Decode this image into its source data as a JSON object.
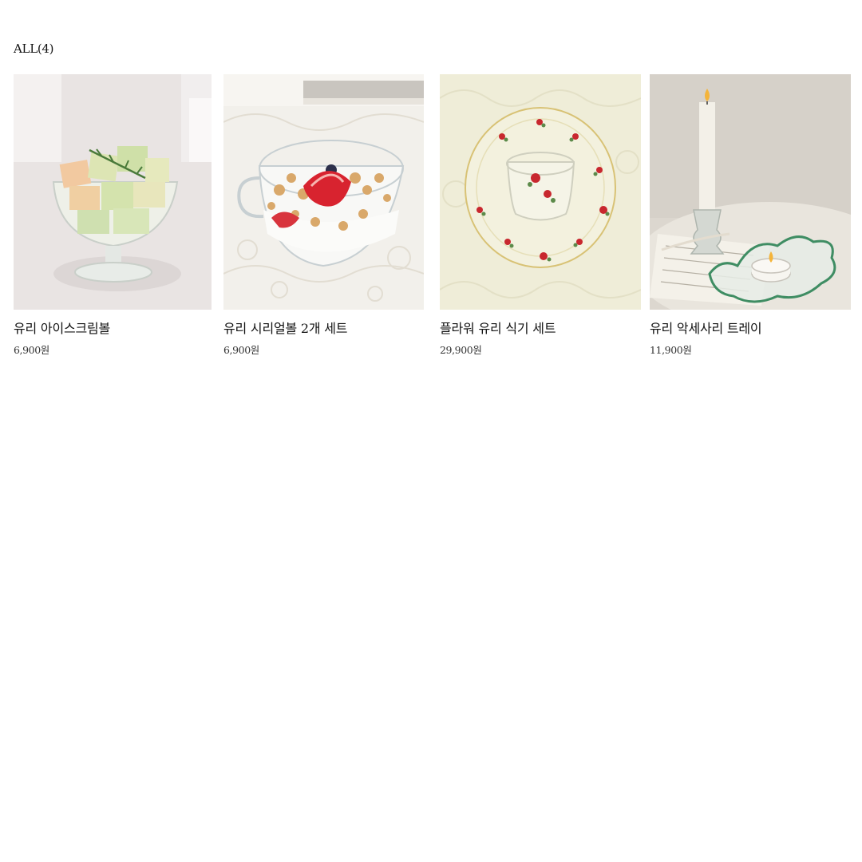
{
  "category": {
    "count_label": "ALL(4)"
  },
  "products": [
    {
      "name": "유리 아이스크림볼",
      "price": "6,900원",
      "image": "melon-in-glass-bowl-photo"
    },
    {
      "name": "유리 시리얼볼 2개 세트",
      "price": "6,900원",
      "image": "yogurt-granola-strawberry-glass-mug-photo"
    },
    {
      "name": "플라워 유리 식기 세트",
      "price": "29,900원",
      "image": "rose-pattern-glass-plate-and-cup-photo"
    },
    {
      "name": "유리 악세사리 트레이",
      "price": "11,900원",
      "image": "candle-and-wavy-glass-tray-photo"
    }
  ]
}
